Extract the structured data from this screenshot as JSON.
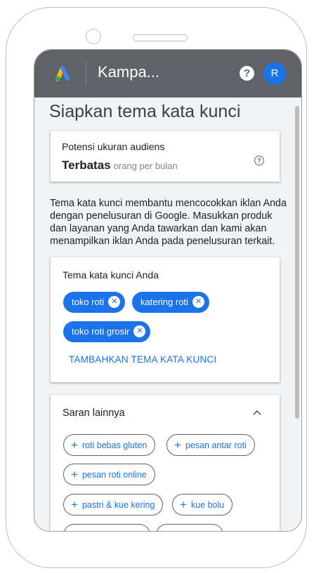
{
  "appbar": {
    "title": "Kampa...",
    "help_icon": "help-icon",
    "avatar_letter": "R"
  },
  "page": {
    "title": "Siapkan tema kata kunci"
  },
  "audience": {
    "label": "Potensi ukuran audiens",
    "value": "Terbatas",
    "unit": "orang per bulan",
    "info_icon": "info-icon"
  },
  "description": "Tema kata kunci membantu mencocokkan iklan Anda dengan penelusuran di Google. Masukkan produk dan layanan yang Anda tawarkan dan kami akan menampilkan iklan Anda pada penelusuran terkait.",
  "keywords": {
    "title": "Tema kata kunci Anda",
    "chips": [
      {
        "label": "toko roti"
      },
      {
        "label": "katering roti"
      },
      {
        "label": "toko roti grosir"
      }
    ],
    "add_label": "TAMBAHKAN TEMA KATA KUNCI"
  },
  "suggestions": {
    "title": "Saran lainnya",
    "chips": [
      {
        "label": "roti bebas gluten"
      },
      {
        "label": "pesan antar roti"
      },
      {
        "label": "pesan roti online"
      },
      {
        "label": "pastri & kue kering"
      },
      {
        "label": "kue bolu"
      }
    ]
  },
  "colors": {
    "accent": "#1a73e8",
    "appbar": "#5f6368",
    "background": "#f1f3f4"
  }
}
